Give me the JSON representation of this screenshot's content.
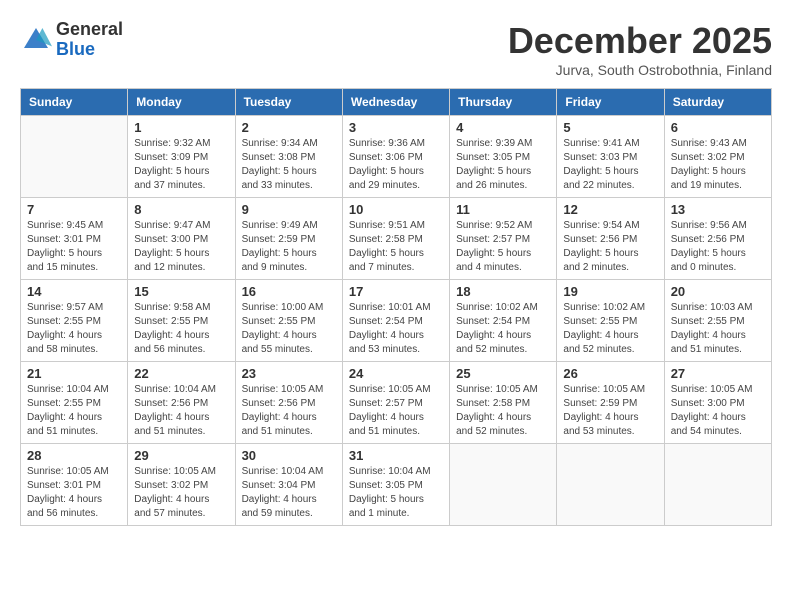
{
  "logo": {
    "general": "General",
    "blue": "Blue"
  },
  "header": {
    "month": "December 2025",
    "location": "Jurva, South Ostrobothnia, Finland"
  },
  "weekdays": [
    "Sunday",
    "Monday",
    "Tuesday",
    "Wednesday",
    "Thursday",
    "Friday",
    "Saturday"
  ],
  "weeks": [
    [
      {
        "day": null
      },
      {
        "day": "1",
        "sunrise": "Sunrise: 9:32 AM",
        "sunset": "Sunset: 3:09 PM",
        "daylight": "Daylight: 5 hours and 37 minutes."
      },
      {
        "day": "2",
        "sunrise": "Sunrise: 9:34 AM",
        "sunset": "Sunset: 3:08 PM",
        "daylight": "Daylight: 5 hours and 33 minutes."
      },
      {
        "day": "3",
        "sunrise": "Sunrise: 9:36 AM",
        "sunset": "Sunset: 3:06 PM",
        "daylight": "Daylight: 5 hours and 29 minutes."
      },
      {
        "day": "4",
        "sunrise": "Sunrise: 9:39 AM",
        "sunset": "Sunset: 3:05 PM",
        "daylight": "Daylight: 5 hours and 26 minutes."
      },
      {
        "day": "5",
        "sunrise": "Sunrise: 9:41 AM",
        "sunset": "Sunset: 3:03 PM",
        "daylight": "Daylight: 5 hours and 22 minutes."
      },
      {
        "day": "6",
        "sunrise": "Sunrise: 9:43 AM",
        "sunset": "Sunset: 3:02 PM",
        "daylight": "Daylight: 5 hours and 19 minutes."
      }
    ],
    [
      {
        "day": "7",
        "sunrise": "Sunrise: 9:45 AM",
        "sunset": "Sunset: 3:01 PM",
        "daylight": "Daylight: 5 hours and 15 minutes."
      },
      {
        "day": "8",
        "sunrise": "Sunrise: 9:47 AM",
        "sunset": "Sunset: 3:00 PM",
        "daylight": "Daylight: 5 hours and 12 minutes."
      },
      {
        "day": "9",
        "sunrise": "Sunrise: 9:49 AM",
        "sunset": "Sunset: 2:59 PM",
        "daylight": "Daylight: 5 hours and 9 minutes."
      },
      {
        "day": "10",
        "sunrise": "Sunrise: 9:51 AM",
        "sunset": "Sunset: 2:58 PM",
        "daylight": "Daylight: 5 hours and 7 minutes."
      },
      {
        "day": "11",
        "sunrise": "Sunrise: 9:52 AM",
        "sunset": "Sunset: 2:57 PM",
        "daylight": "Daylight: 5 hours and 4 minutes."
      },
      {
        "day": "12",
        "sunrise": "Sunrise: 9:54 AM",
        "sunset": "Sunset: 2:56 PM",
        "daylight": "Daylight: 5 hours and 2 minutes."
      },
      {
        "day": "13",
        "sunrise": "Sunrise: 9:56 AM",
        "sunset": "Sunset: 2:56 PM",
        "daylight": "Daylight: 5 hours and 0 minutes."
      }
    ],
    [
      {
        "day": "14",
        "sunrise": "Sunrise: 9:57 AM",
        "sunset": "Sunset: 2:55 PM",
        "daylight": "Daylight: 4 hours and 58 minutes."
      },
      {
        "day": "15",
        "sunrise": "Sunrise: 9:58 AM",
        "sunset": "Sunset: 2:55 PM",
        "daylight": "Daylight: 4 hours and 56 minutes."
      },
      {
        "day": "16",
        "sunrise": "Sunrise: 10:00 AM",
        "sunset": "Sunset: 2:55 PM",
        "daylight": "Daylight: 4 hours and 55 minutes."
      },
      {
        "day": "17",
        "sunrise": "Sunrise: 10:01 AM",
        "sunset": "Sunset: 2:54 PM",
        "daylight": "Daylight: 4 hours and 53 minutes."
      },
      {
        "day": "18",
        "sunrise": "Sunrise: 10:02 AM",
        "sunset": "Sunset: 2:54 PM",
        "daylight": "Daylight: 4 hours and 52 minutes."
      },
      {
        "day": "19",
        "sunrise": "Sunrise: 10:02 AM",
        "sunset": "Sunset: 2:55 PM",
        "daylight": "Daylight: 4 hours and 52 minutes."
      },
      {
        "day": "20",
        "sunrise": "Sunrise: 10:03 AM",
        "sunset": "Sunset: 2:55 PM",
        "daylight": "Daylight: 4 hours and 51 minutes."
      }
    ],
    [
      {
        "day": "21",
        "sunrise": "Sunrise: 10:04 AM",
        "sunset": "Sunset: 2:55 PM",
        "daylight": "Daylight: 4 hours and 51 minutes."
      },
      {
        "day": "22",
        "sunrise": "Sunrise: 10:04 AM",
        "sunset": "Sunset: 2:56 PM",
        "daylight": "Daylight: 4 hours and 51 minutes."
      },
      {
        "day": "23",
        "sunrise": "Sunrise: 10:05 AM",
        "sunset": "Sunset: 2:56 PM",
        "daylight": "Daylight: 4 hours and 51 minutes."
      },
      {
        "day": "24",
        "sunrise": "Sunrise: 10:05 AM",
        "sunset": "Sunset: 2:57 PM",
        "daylight": "Daylight: 4 hours and 51 minutes."
      },
      {
        "day": "25",
        "sunrise": "Sunrise: 10:05 AM",
        "sunset": "Sunset: 2:58 PM",
        "daylight": "Daylight: 4 hours and 52 minutes."
      },
      {
        "day": "26",
        "sunrise": "Sunrise: 10:05 AM",
        "sunset": "Sunset: 2:59 PM",
        "daylight": "Daylight: 4 hours and 53 minutes."
      },
      {
        "day": "27",
        "sunrise": "Sunrise: 10:05 AM",
        "sunset": "Sunset: 3:00 PM",
        "daylight": "Daylight: 4 hours and 54 minutes."
      }
    ],
    [
      {
        "day": "28",
        "sunrise": "Sunrise: 10:05 AM",
        "sunset": "Sunset: 3:01 PM",
        "daylight": "Daylight: 4 hours and 56 minutes."
      },
      {
        "day": "29",
        "sunrise": "Sunrise: 10:05 AM",
        "sunset": "Sunset: 3:02 PM",
        "daylight": "Daylight: 4 hours and 57 minutes."
      },
      {
        "day": "30",
        "sunrise": "Sunrise: 10:04 AM",
        "sunset": "Sunset: 3:04 PM",
        "daylight": "Daylight: 4 hours and 59 minutes."
      },
      {
        "day": "31",
        "sunrise": "Sunrise: 10:04 AM",
        "sunset": "Sunset: 3:05 PM",
        "daylight": "Daylight: 5 hours and 1 minute."
      },
      {
        "day": null
      },
      {
        "day": null
      },
      {
        "day": null
      }
    ]
  ]
}
